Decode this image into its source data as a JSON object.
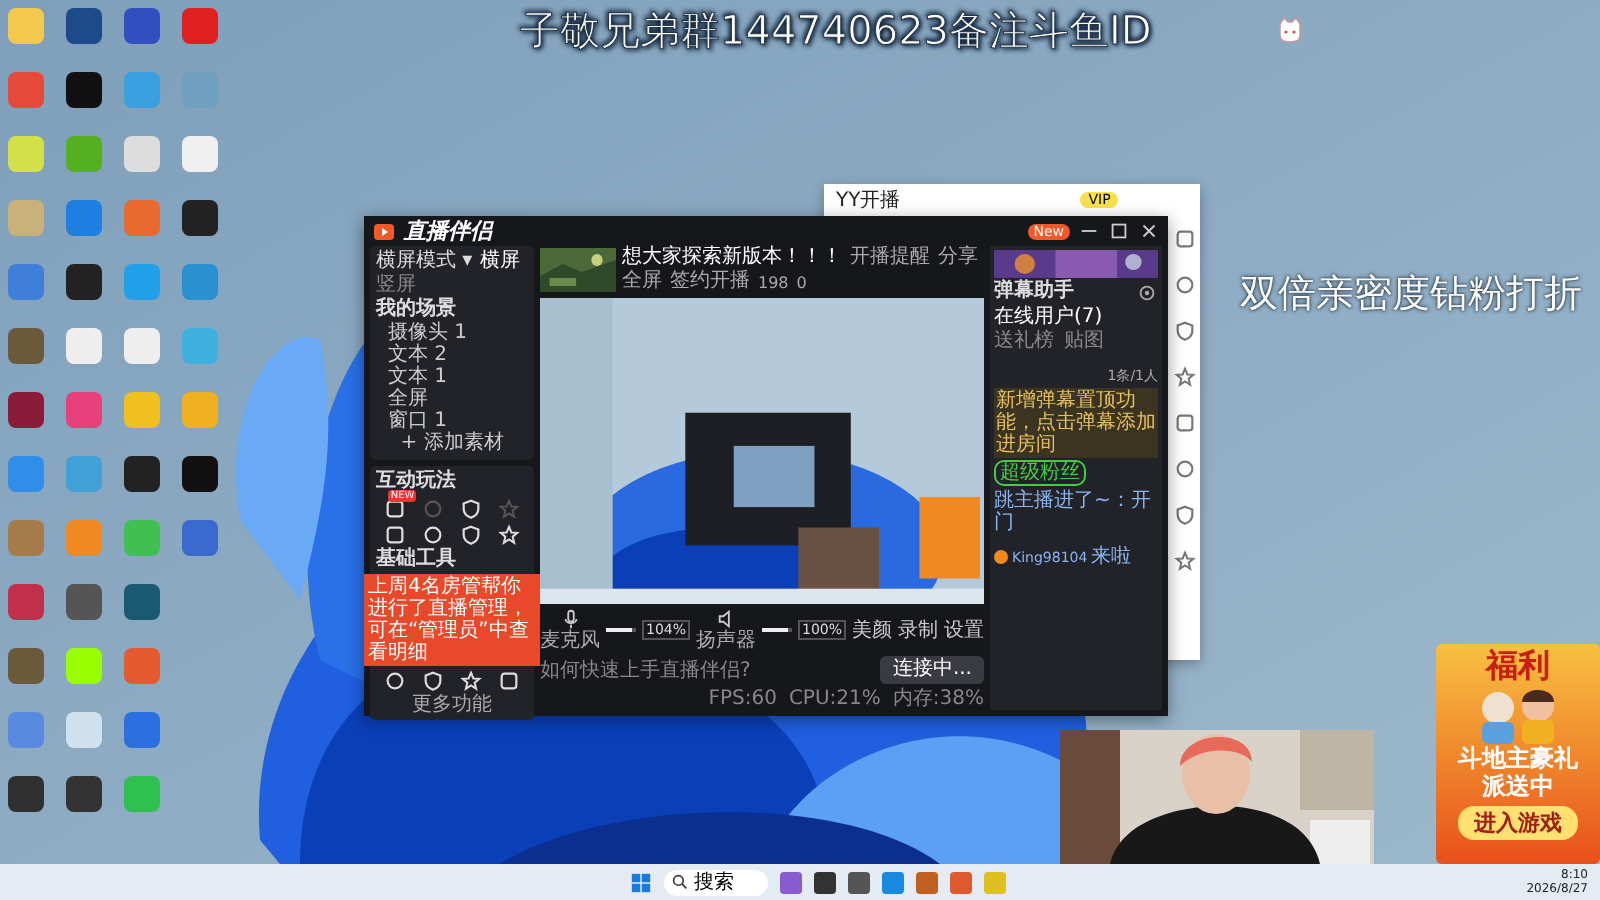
{
  "overlay_texts": [
    "子敬兄弟群144740623备注斗鱼ID",
    "双倍亲密度钻粉打折"
  ],
  "yy_window": {
    "title": "YY开播",
    "vip": "VIP"
  },
  "app": {
    "title": "直播伴侣",
    "badge": "New",
    "mode": "横屏模式 ▾",
    "mode_options": [
      {
        "label": "横屏",
        "selected": true
      },
      {
        "label": "竖屏",
        "selected": false
      }
    ],
    "scenes_title": "我的场景",
    "sources": [
      "摄像头 1",
      "文本 2",
      "文本 1",
      "全屏",
      "窗口 1"
    ],
    "add_source": "+ 添加素材",
    "interactive_title": "互动玩法",
    "interactive_tools": [
      {
        "disabled": false,
        "badge": "NEW"
      },
      {
        "disabled": true
      },
      {
        "disabled": false
      },
      {
        "disabled": true
      },
      {
        "disabled": false
      },
      {
        "disabled": false
      },
      {
        "disabled": false
      },
      {
        "disabled": false
      }
    ],
    "basic_title": "基础工具",
    "basic_tools": [
      {
        "disabled": false
      },
      {
        "disabled": false
      },
      {
        "disabled": false
      },
      {
        "disabled": false
      }
    ],
    "more": "更多功能",
    "toast": "上周4名房管帮你进行了直播管理，可在“管理员”中查看明细",
    "stream_title": "想大家探索新版本！！！",
    "actions": [
      "开播提醒",
      "分享"
    ],
    "stats": [
      "全屏",
      "签约开播",
      "198",
      "0"
    ],
    "mixer": [
      {
        "label": "麦克风",
        "level": 0.85,
        "reading": "104%"
      },
      {
        "label": "扬声器",
        "level": 0.85,
        "reading": "100%"
      }
    ],
    "controls": [
      "美颜",
      "录制",
      "设置"
    ],
    "go_live": "连接中...",
    "help": "如何快速上手直播伴侣?",
    "status": [
      "FPS:60",
      "CPU:21%",
      "内存:38%"
    ],
    "assistant": {
      "title": "弹幕助手",
      "tabs": [
        {
          "label": "在线用户(7)",
          "selected": true
        },
        {
          "label": "送礼榜",
          "selected": false
        },
        {
          "label": "贴图",
          "selected": false
        }
      ],
      "count": "1条/1人",
      "notice": "新增弹幕置顶功能，点击弹幕添加进房间",
      "message": {
        "badge": "超级粉丝",
        "text": "跳主播进了~：开门"
      },
      "follow": {
        "user": "King98104",
        "text": "来啦"
      }
    }
  },
  "ad": {
    "headline": "福利",
    "line1": "斗地主豪礼",
    "line2": "派送中",
    "button": "进入游戏"
  },
  "taskbar": {
    "search": "搜索",
    "time": "8:10",
    "date": "2026/8/27"
  }
}
